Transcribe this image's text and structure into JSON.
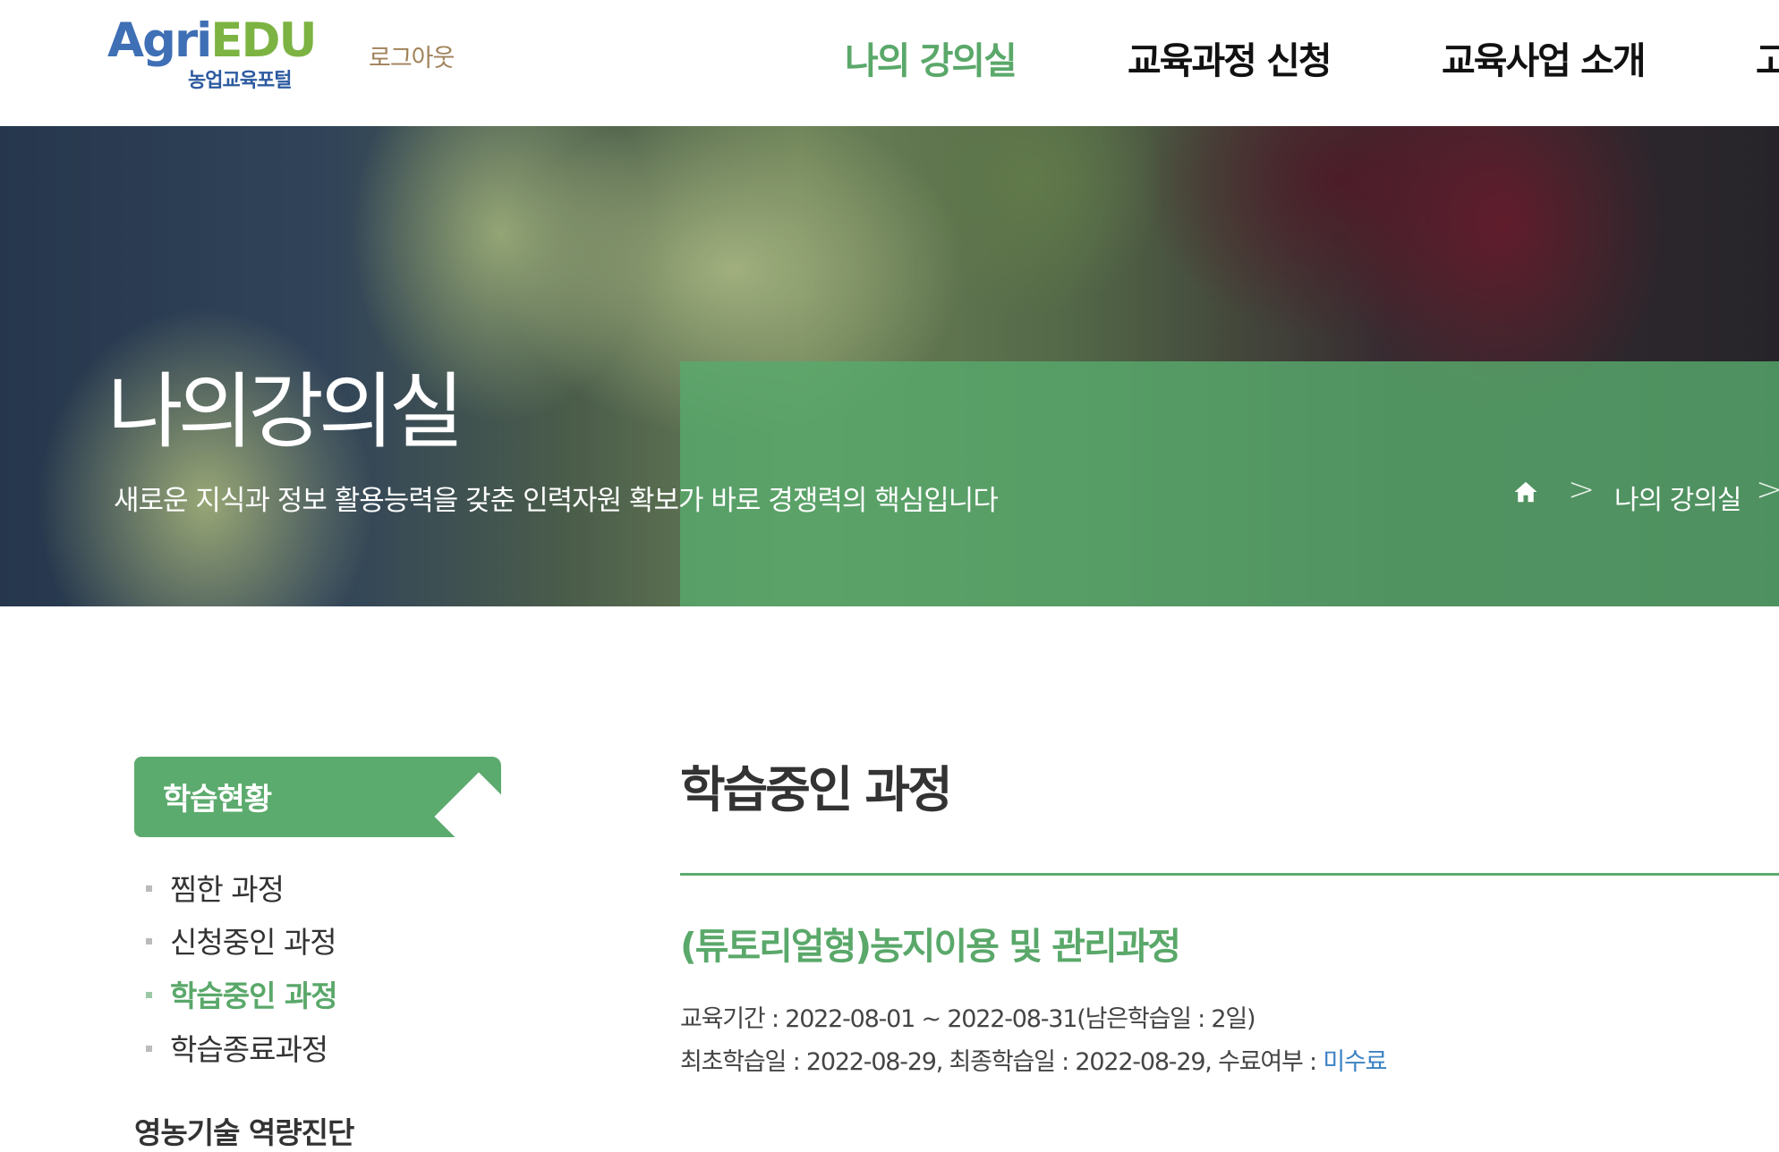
{
  "header": {
    "logo": {
      "main_a": "Agri",
      "main_b": "EDU",
      "sub": "농업교육포털"
    },
    "logout_label": "로그아웃",
    "nav": [
      {
        "label": "나의 강의실",
        "active": true
      },
      {
        "label": "교육과정 신청",
        "active": false
      },
      {
        "label": "교육사업 소개",
        "active": false
      },
      {
        "label": "고",
        "active": false
      }
    ]
  },
  "hero": {
    "title": "나의강의실",
    "subtitle": "새로운 지식과 정보 활용능력을 갖춘 인력자원 확보가 바로 경쟁력의 핵심입니다",
    "breadcrumb": {
      "home_icon": "home-icon",
      "separator": ">",
      "current": "나의 강의실"
    }
  },
  "sidebar": {
    "heading": "학습현황",
    "items": [
      {
        "label": "찜한 과정",
        "active": false
      },
      {
        "label": "신청중인 과정",
        "active": false
      },
      {
        "label": "학습중인 과정",
        "active": true
      },
      {
        "label": "학습종료과정",
        "active": false
      }
    ],
    "next_section": "영농기술 역량진단"
  },
  "main": {
    "title": "학습중인 과정",
    "course": {
      "title": "(튜토리얼형)농지이용 및 관리과정",
      "period_line": "교육기간 : 2022-08-01 ~ 2022-08-31(남은학습일 : 2일)",
      "study_line_prefix": "최초학습일 : 2022-08-29, 최종학습일 : 2022-08-29, 수료여부 : ",
      "completion_status": "미수료"
    }
  },
  "colors": {
    "accent_green": "#5cab6e",
    "logo_blue": "#3f6fb5",
    "logo_green": "#7cb342",
    "link_blue": "#3b82c4",
    "logout_brown": "#a0825a"
  }
}
